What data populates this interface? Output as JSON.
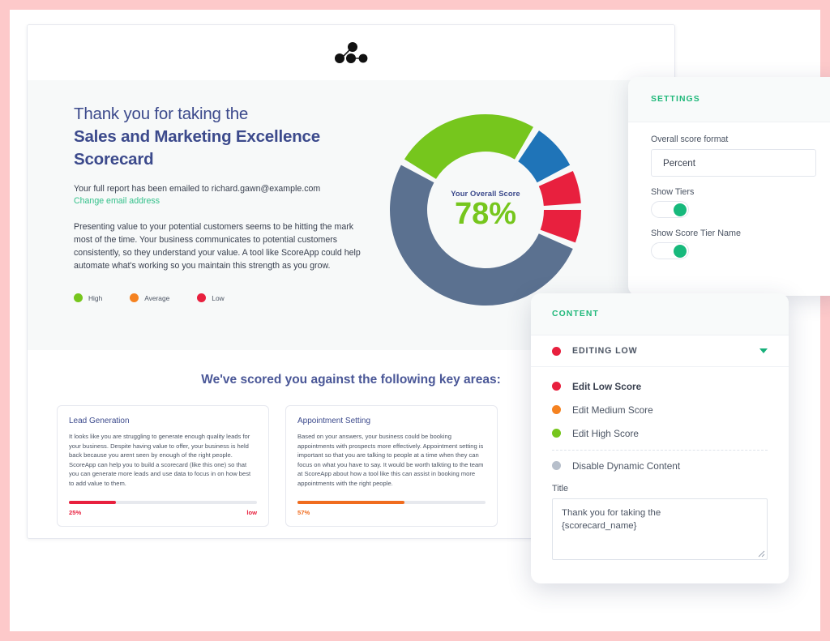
{
  "theme": {
    "frame_color": "#fdc9ca",
    "brand_green": "#20b87a",
    "heading_navy": "#3c4a8c",
    "high_color": "#76c61d",
    "average_color": "#f58220",
    "low_color": "#e8203e",
    "slate_color": "#5b7190",
    "blue_color": "#1f74b8"
  },
  "scorecard": {
    "logo_name": "scoreapp-node-logo",
    "title_line1": "Thank you for taking the",
    "title_line2": "Sales and Marketing Excellence",
    "title_line3": "Scorecard",
    "email_text": "Your full report has been emailed to richard.gawn@example.com",
    "email_link": "Change email address",
    "body_copy": "Presenting value to your potential customers seems to be hitting the mark most of the time. Your business communicates to potential customers consistently, so they understand your value. A tool like ScoreApp could help automate what's working so you maintain this strength as you grow.",
    "legend": [
      {
        "label": "High",
        "color": "#76c61d"
      },
      {
        "label": "Average",
        "color": "#f58220"
      },
      {
        "label": "Low",
        "color": "#e8203e"
      }
    ],
    "score": {
      "caption": "Your Overall Score",
      "value": "78%"
    },
    "areas_heading": "We've scored you against the following key areas:",
    "areas": [
      {
        "title": "Lead Generation",
        "text": "It looks like you are struggling to generate enough quality leads for your business. Despite having value to offer, your business is held back because you arent seen by enough of the right people. ScoreApp can help you to build a scorecard (like this one) so that you can generate more leads and use data to focus in on how best to add value to them.",
        "percent_label": "25%",
        "percent": 25,
        "tier_label": "low",
        "color": "#e8203e"
      },
      {
        "title": "Appointment Setting",
        "text": "Based on your answers, your business could be booking appointments with prospects more effectively. Appointment setting is important so that you are talking to people at a time when they can focus on what you have to say. It would be worth talkting to the team at ScoreApp about how a tool like this can assist in booking more appointments with the right people.",
        "percent_label": "57%",
        "percent": 57,
        "tier_label": "",
        "color": "#f06c1e"
      }
    ]
  },
  "chart_data": {
    "type": "pie",
    "title": "Your Overall Score",
    "center_value": "78%",
    "legend_position": "left",
    "categories": [
      "High",
      "Average",
      "Low"
    ],
    "segments": [
      {
        "name": "segment-green-high",
        "color": "#76c61d",
        "start_deg": 302,
        "end_deg": 30,
        "tier": "High"
      },
      {
        "name": "segment-blue",
        "color": "#1f74b8",
        "start_deg": 34,
        "end_deg": 62,
        "tier": "High"
      },
      {
        "name": "segment-red-1",
        "color": "#e8203e",
        "start_deg": 66,
        "end_deg": 86,
        "tier": "Low"
      },
      {
        "name": "segment-red-2",
        "color": "#e8203e",
        "start_deg": 90,
        "end_deg": 110,
        "tier": "Low"
      },
      {
        "name": "segment-slate",
        "color": "#5b7190",
        "start_deg": 114,
        "end_deg": 298,
        "tier": ""
      }
    ]
  },
  "settings_panel": {
    "header": "SETTINGS",
    "score_format_label": "Overall score format",
    "score_format_value": "Percent",
    "score_format_options": [
      "Percent"
    ],
    "toggles": [
      {
        "label": "Show Tiers",
        "on": true
      },
      {
        "label": "Show Score Tier Name",
        "on": true
      }
    ]
  },
  "content_panel": {
    "header": "CONTENT",
    "editing_row": {
      "label": "EDITING LOW",
      "dot_color": "#e8203e"
    },
    "options": [
      {
        "label": "Edit Low Score",
        "color": "#e8203e",
        "active": true
      },
      {
        "label": "Edit Medium Score",
        "color": "#f58220",
        "active": false
      },
      {
        "label": "Edit High Score",
        "color": "#76c61d",
        "active": false
      }
    ],
    "disable_option": {
      "label": "Disable Dynamic Content",
      "color": "#b7bfcb"
    },
    "title_label": "Title",
    "title_value": "Thank you for taking the\n{scorecard_name}"
  }
}
